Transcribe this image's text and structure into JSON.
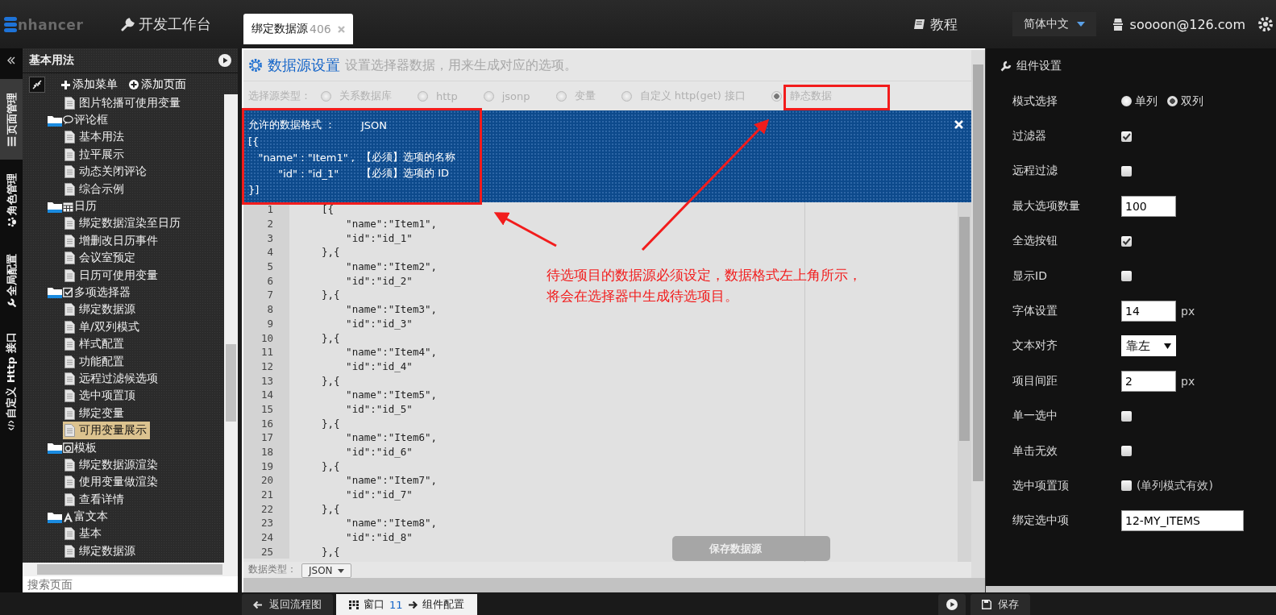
{
  "topbar": {
    "logo": "nhancer",
    "workbench": "开发工作台",
    "tab": {
      "label": "绑定数据源",
      "count": "406"
    },
    "tutorial": "教程",
    "language": "简体中文",
    "user": "soooon@126.com"
  },
  "side_tabs": [
    {
      "label": "页面管理",
      "kind": "list",
      "selected": true
    },
    {
      "label": "角色管理",
      "kind": "paw",
      "selected": false
    },
    {
      "label": "全局配置",
      "kind": "wrench",
      "selected": false
    },
    {
      "label": "自定义 Http 接口",
      "kind": "code",
      "selected": false
    }
  ],
  "sidebar": {
    "title": "基本用法",
    "add_menu": "添加菜单",
    "add_page": "添加页面",
    "search_placeholder": "搜索页面",
    "tree": [
      {
        "label": "图片轮播可使用变量",
        "kind": "page",
        "selected": false
      },
      {
        "label": "评论框",
        "kind": "comment",
        "selected": false,
        "children": [
          {
            "label": "基本用法",
            "selected": false
          },
          {
            "label": "拉平展示",
            "selected": false
          },
          {
            "label": "动态关闭评论",
            "selected": false
          },
          {
            "label": "综合示例",
            "selected": false
          }
        ]
      },
      {
        "label": "日历",
        "kind": "calendar",
        "selected": false,
        "children": [
          {
            "label": "绑定数据渲染至日历",
            "selected": false
          },
          {
            "label": "增删改日历事件",
            "selected": false
          },
          {
            "label": "会议室预定",
            "selected": false
          },
          {
            "label": "日历可使用变量",
            "selected": false
          }
        ]
      },
      {
        "label": "多项选择器",
        "kind": "checkbox",
        "selected": false,
        "children": [
          {
            "label": "绑定数据源",
            "selected": false
          },
          {
            "label": "单/双列模式",
            "selected": false
          },
          {
            "label": "样式配置",
            "selected": false
          },
          {
            "label": "功能配置",
            "selected": false
          },
          {
            "label": "远程过滤候选项",
            "selected": false
          },
          {
            "label": "选中项置顶",
            "selected": false
          },
          {
            "label": "绑定变量",
            "selected": false
          },
          {
            "label": "可用变量展示",
            "selected": true
          }
        ]
      },
      {
        "label": "模板",
        "kind": "template",
        "selected": false,
        "children": [
          {
            "label": "绑定数据源渲染",
            "selected": false
          },
          {
            "label": "使用变量做渲染",
            "selected": false
          },
          {
            "label": "查看详情",
            "selected": false
          }
        ]
      },
      {
        "label": "富文本",
        "kind": "text",
        "selected": false,
        "children": [
          {
            "label": "基本",
            "selected": false
          },
          {
            "label": "绑定数据源",
            "selected": false
          }
        ]
      }
    ]
  },
  "datasource": {
    "title": "数据源设置",
    "subtitle": "设置选择器数据，用来生成对应的选项。",
    "source_label": "选择源类型：",
    "disabled": true,
    "sources": [
      {
        "label": "关系数据库",
        "selected": false
      },
      {
        "label": "http",
        "selected": false
      },
      {
        "label": "jsonp",
        "selected": false
      },
      {
        "label": "变量",
        "selected": false
      },
      {
        "label": "自定义 http(get) 接口",
        "selected": false
      },
      {
        "label": "静态数据",
        "selected": true
      }
    ],
    "format_lines": [
      {
        "code": "允许的数据格式 ：",
        "note": "JSON"
      },
      {
        "code": "[{"
      },
      {
        "code": "   \"name\" : \"Item1\" ,",
        "note": "【必须】选项的名称"
      },
      {
        "code": "         \"id\" : \"id_1\"",
        "note": "【必须】选项的 ID"
      },
      {
        "code": "}]"
      }
    ],
    "editor_lines": [
      {
        "no": "1",
        "code": "[{"
      },
      {
        "no": "2",
        "code": "    \"name\":\"Item1\","
      },
      {
        "no": "3",
        "code": "    \"id\":\"id_1\""
      },
      {
        "no": "4",
        "code": "},{"
      },
      {
        "no": "5",
        "code": "    \"name\":\"Item2\","
      },
      {
        "no": "6",
        "code": "    \"id\":\"id_2\""
      },
      {
        "no": "7",
        "code": "},{"
      },
      {
        "no": "8",
        "code": "    \"name\":\"Item3\","
      },
      {
        "no": "9",
        "code": "    \"id\":\"id_3\""
      },
      {
        "no": "10",
        "code": "},{"
      },
      {
        "no": "11",
        "code": "    \"name\":\"Item4\","
      },
      {
        "no": "12",
        "code": "    \"id\":\"id_4\""
      },
      {
        "no": "13",
        "code": "},{"
      },
      {
        "no": "14",
        "code": "    \"name\":\"Item5\","
      },
      {
        "no": "15",
        "code": "    \"id\":\"id_5\""
      },
      {
        "no": "16",
        "code": "},{"
      },
      {
        "no": "17",
        "code": "    \"name\":\"Item6\","
      },
      {
        "no": "18",
        "code": "    \"id\":\"id_6\""
      },
      {
        "no": "19",
        "code": "},{"
      },
      {
        "no": "20",
        "code": "    \"name\":\"Item7\","
      },
      {
        "no": "21",
        "code": "    \"id\":\"id_7\""
      },
      {
        "no": "22",
        "code": "},{"
      },
      {
        "no": "23",
        "code": "    \"name\":\"Item8\","
      },
      {
        "no": "24",
        "code": "    \"id\":\"id_8\""
      },
      {
        "no": "25",
        "code": "},{"
      }
    ],
    "save_button": "保存数据源",
    "type_label": "数据类型：",
    "type_value": "JSON",
    "annotation": [
      "待选项目的数据源必须设定，数据格式左上角所示，",
      "将会在选择器中生成待选项目。"
    ]
  },
  "settings": {
    "title": "组件设置",
    "rows": [
      {
        "kind": "radio",
        "label": "模式选择",
        "options": [
          {
            "label": "单列",
            "selected": false
          },
          {
            "label": "双列",
            "selected": true
          }
        ]
      },
      {
        "kind": "checkbox",
        "label": "过滤器",
        "checked": true
      },
      {
        "kind": "checkbox",
        "label": "远程过滤",
        "checked": false
      },
      {
        "kind": "number",
        "label": "最大选项数量",
        "value": "100"
      },
      {
        "kind": "checkbox",
        "label": "全选按钮",
        "checked": true
      },
      {
        "kind": "checkbox",
        "label": "显示ID",
        "checked": false
      },
      {
        "kind": "number",
        "label": "字体设置",
        "value": "14",
        "unit": "px"
      },
      {
        "kind": "select",
        "label": "文本对齐",
        "value": "靠左"
      },
      {
        "kind": "number",
        "label": "项目间距",
        "value": "2",
        "unit": "px"
      },
      {
        "kind": "checkbox",
        "label": "单一选中",
        "checked": false
      },
      {
        "kind": "checkbox",
        "label": "单击无效",
        "checked": false
      },
      {
        "kind": "checkbox",
        "label": "选中项置顶",
        "checked": false,
        "note": "(单列模式有效)"
      },
      {
        "kind": "text",
        "label": "绑定选中项",
        "value": "12-MY_ITEMS"
      }
    ]
  },
  "bottombar": {
    "back": "返回流程图",
    "window_label": "窗口",
    "window_no": "11",
    "window_target": "组件配置",
    "save": "保存"
  }
}
